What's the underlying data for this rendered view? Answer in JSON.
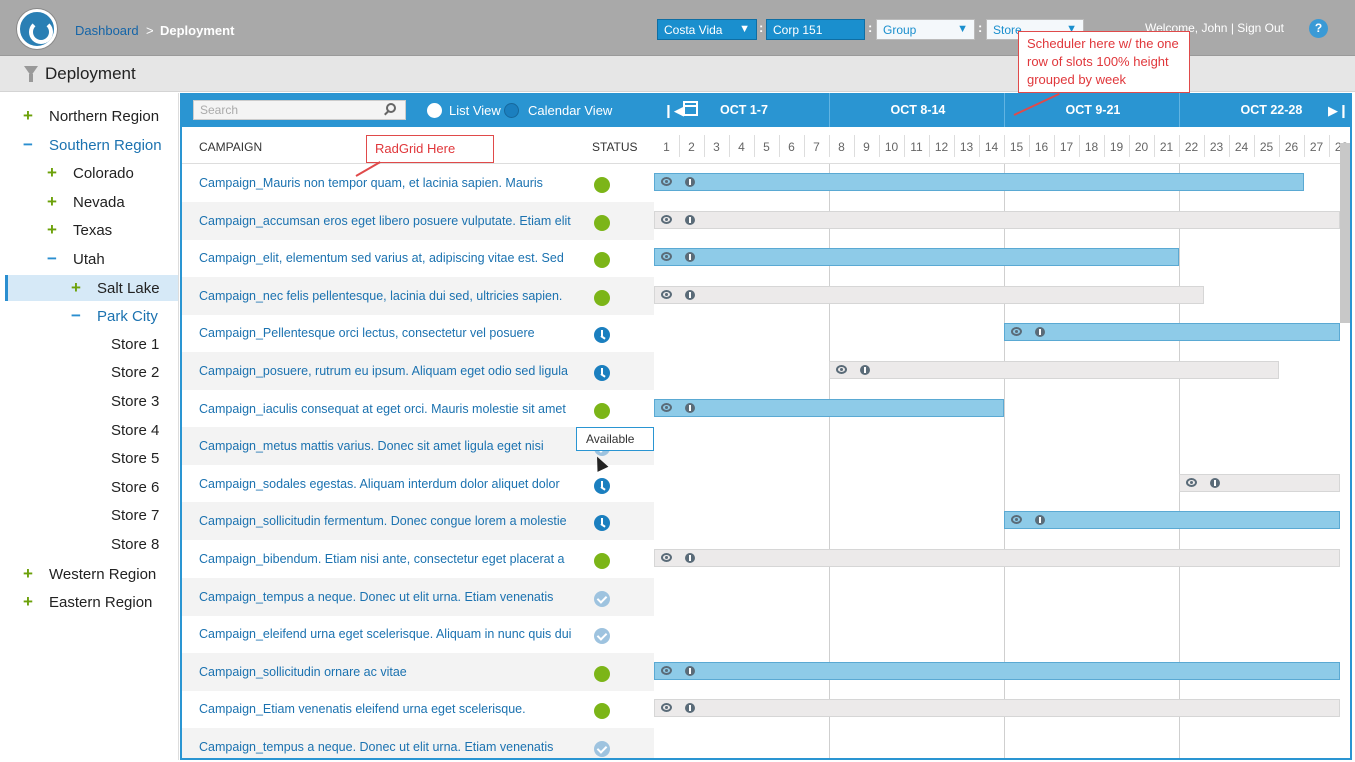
{
  "header": {
    "breadcrumb_root": "Dashboard",
    "breadcrumb_sep": ">",
    "breadcrumb_current": "Deployment",
    "brand_select": "Costa Vida",
    "corp_select": "Corp 151",
    "group_select": "Group",
    "store_select": "Store",
    "welcome": "Welcome, John | Sign Out",
    "help": "?"
  },
  "page_title": "Deployment",
  "tree": [
    {
      "sign": "+",
      "label": "Northern Region",
      "level": 0
    },
    {
      "sign": "−",
      "label": "Southern Region",
      "level": 0
    },
    {
      "sign": "+",
      "label": "Colorado",
      "level": 1
    },
    {
      "sign": "+",
      "label": "Nevada",
      "level": 1
    },
    {
      "sign": "+",
      "label": "Texas",
      "level": 1
    },
    {
      "sign": "−",
      "label": "Utah",
      "level": 1
    },
    {
      "sign": "+",
      "label": "Salt Lake",
      "level": 2,
      "selected": true
    },
    {
      "sign": "−",
      "label": "Park City",
      "level": 2
    },
    {
      "sign": "",
      "label": "Store 1",
      "level": 3
    },
    {
      "sign": "",
      "label": "Store 2",
      "level": 3
    },
    {
      "sign": "",
      "label": "Store 3",
      "level": 3
    },
    {
      "sign": "",
      "label": "Store 4",
      "level": 3
    },
    {
      "sign": "",
      "label": "Store 5",
      "level": 3
    },
    {
      "sign": "",
      "label": "Store 6",
      "level": 3
    },
    {
      "sign": "",
      "label": "Store 7",
      "level": 3
    },
    {
      "sign": "",
      "label": "Store 8",
      "level": 3
    },
    {
      "sign": "+",
      "label": "Western Region",
      "level": 0
    },
    {
      "sign": "+",
      "label": "Eastern Region",
      "level": 0
    }
  ],
  "toolbar": {
    "search_placeholder": "Search",
    "list_view": "List View",
    "calendar_view": "Calendar View"
  },
  "grid": {
    "col_campaign": "CAMPAIGN",
    "col_status": "STATUS",
    "rows": [
      {
        "name": "Campaign_Mauris non tempor quam, et lacinia sapien. Mauris",
        "status": "green",
        "bar": {
          "type": "blue",
          "start": 1,
          "end": 26
        }
      },
      {
        "name": "Campaign_accumsan eros eget libero posuere vulputate. Etiam elit",
        "status": "green",
        "bar": {
          "type": "grey",
          "start": 1,
          "end": 28
        }
      },
      {
        "name": "Campaign_elit, elementum sed varius at, adipiscing vitae est. Sed",
        "status": "green",
        "bar": {
          "type": "blue",
          "start": 1,
          "end": 21
        }
      },
      {
        "name": "Campaign_nec felis pellentesque, lacinia dui sed, ultricies sapien.",
        "status": "green",
        "bar": {
          "type": "grey",
          "start": 1,
          "end": 22
        }
      },
      {
        "name": "Campaign_Pellentesque orci lectus, consectetur vel posuere",
        "status": "clock",
        "bar": {
          "type": "blue",
          "start": 15,
          "end": 28
        }
      },
      {
        "name": "Campaign_posuere, rutrum eu ipsum. Aliquam eget odio sed ligula",
        "status": "clock",
        "bar": {
          "type": "grey",
          "start": 8,
          "end": 25
        }
      },
      {
        "name": "Campaign_iaculis consequat at eget orci. Mauris molestie sit amet",
        "status": "green",
        "bar": {
          "type": "blue",
          "start": 1,
          "end": 14
        }
      },
      {
        "name": "Campaign_metus mattis varius. Donec sit amet ligula eget nisi",
        "status": "check",
        "bar": null
      },
      {
        "name": "Campaign_sodales egestas. Aliquam interdum dolor aliquet dolor",
        "status": "clock",
        "bar": {
          "type": "grey",
          "start": 22,
          "end": 28
        }
      },
      {
        "name": "Campaign_sollicitudin fermentum. Donec congue lorem a molestie",
        "status": "clock",
        "bar": {
          "type": "blue",
          "start": 15,
          "end": 28
        }
      },
      {
        "name": "Campaign_bibendum. Etiam nisi ante, consectetur eget placerat a",
        "status": "green",
        "bar": {
          "type": "grey",
          "start": 1,
          "end": 28
        }
      },
      {
        "name": "Campaign_tempus a neque. Donec ut elit urna. Etiam venenatis",
        "status": "check",
        "bar": null
      },
      {
        "name": "Campaign_eleifend urna eget scelerisque. Aliquam in nunc quis dui",
        "status": "check",
        "bar": null
      },
      {
        "name": "Campaign_sollicitudin ornare ac vitae",
        "status": "green",
        "bar": {
          "type": "blue",
          "start": 1,
          "end": 28
        }
      },
      {
        "name": "Campaign_Etiam venenatis eleifend urna eget scelerisque.",
        "status": "green",
        "bar": {
          "type": "grey",
          "start": 1,
          "end": 28
        }
      },
      {
        "name": "Campaign_tempus a neque. Donec ut elit urna. Etiam venenatis",
        "status": "check",
        "bar": null
      }
    ]
  },
  "scheduler": {
    "weeks": [
      "OCT 1-7",
      "OCT 8-14",
      "OCT 9-21",
      "OCT 22-28"
    ],
    "days": [
      "1",
      "2",
      "3",
      "4",
      "5",
      "6",
      "7",
      "8",
      "9",
      "10",
      "11",
      "12",
      "13",
      "14",
      "15",
      "16",
      "17",
      "18",
      "19",
      "20",
      "21",
      "22",
      "23",
      "24",
      "25",
      "26",
      "27",
      "28"
    ]
  },
  "annotations": {
    "radgrid": "RadGrid Here",
    "scheduler": "Scheduler here w/ the one row of slots 100% height grouped by week"
  },
  "tooltip": "Available",
  "colors": {
    "accent": "#2a95d2",
    "status_green": "#7cb518",
    "status_clock": "#1b7fbf",
    "status_check": "#9ec3df",
    "bar_blue": "#8ecbe8",
    "bar_grey": "#eceaea",
    "annotation_red": "#e04a4a"
  }
}
